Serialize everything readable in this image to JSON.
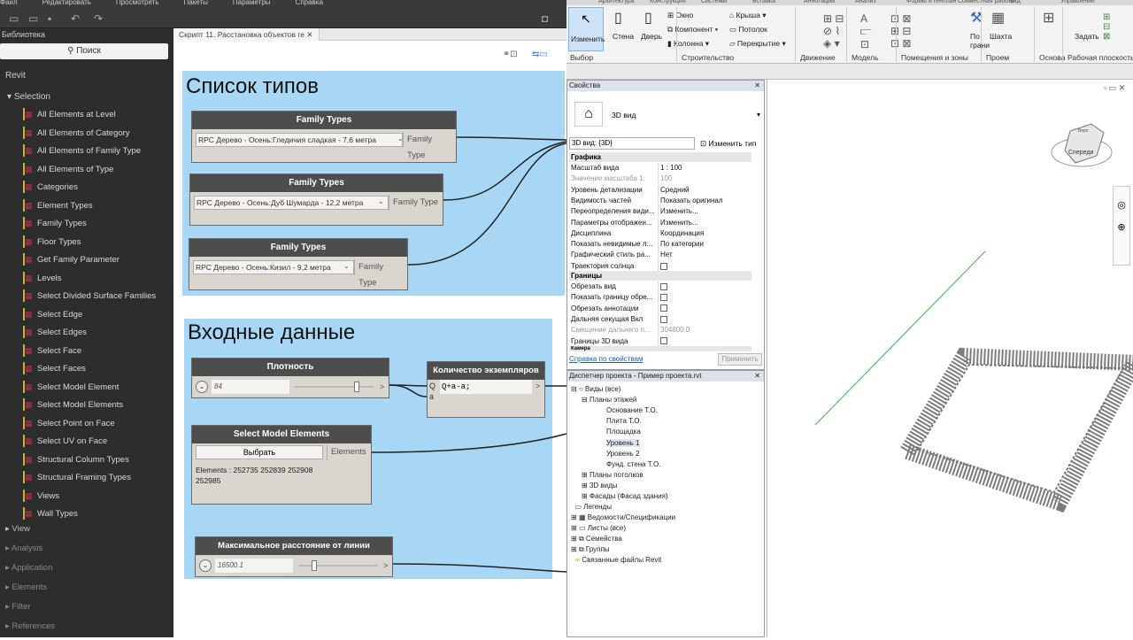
{
  "menubar": [
    "Файл",
    "Редактировать",
    "Просмотреть",
    "Пакеты",
    "Параметры",
    "Справка"
  ],
  "library": {
    "header": "Библиотека",
    "search_placeholder": "Поиск",
    "root": "Revit",
    "selection_label": "Selection",
    "items": [
      "All Elements at Level",
      "All Elements of Category",
      "All Elements of Family Type",
      "All Elements of Type",
      "Categories",
      "Element Types",
      "Family Types",
      "Floor Types",
      "Get Family Parameter",
      "Levels",
      "Select Divided Surface Families",
      "Select Edge",
      "Select Edges",
      "Select Face",
      "Select Faces",
      "Select Model Element",
      "Select Model Elements",
      "Select Point on Face",
      "Select UV on Face",
      "Structural Column Types",
      "Structural Framing Types",
      "Views",
      "Wall Types"
    ],
    "sections": [
      "View",
      "Analysis",
      "Application",
      "Elements",
      "Filter",
      "References"
    ]
  },
  "workspace": {
    "tab_label": "Скрипт 11. Расстановка объектов ге",
    "group1_title": "Список типов",
    "group2_title": "Входные данные",
    "family_nodes": [
      {
        "title": "Family Types",
        "value": "RPC Дерево - Осень:Гледичия сладкая - 7,6 метра",
        "port": "Family Type"
      },
      {
        "title": "Family Types",
        "value": "RPC Дерево - Осень:Дуб Шумарда - 12,2 метра",
        "port": "Family Type"
      },
      {
        "title": "Family Types",
        "value": "RPC Дерево - Осень:Кизил - 9,2 метра",
        "port": "Family Type"
      }
    ],
    "density_node": {
      "title": "Плотность",
      "value": "84",
      "level": 0.78
    },
    "count_node": {
      "title": "Количество экземпляров",
      "port_q": "Q",
      "port_a": "a",
      "formula": "Q+a-a;",
      "out": ">"
    },
    "select_node": {
      "title": "Select Model Elements",
      "button": "Выбрать",
      "port": "Elements",
      "result": "Elements : 252735 252839 252908 252985"
    },
    "distance_node": {
      "title": "Максимальное расстояние от линии",
      "value": "16500.1",
      "level": 0.2
    }
  },
  "ribbon": {
    "tabs": [
      "Архитектура",
      "Конструкция",
      "Системы",
      "Вставка",
      "Аннотации",
      "Анализ",
      "Формы и генплан",
      "Совместная работа",
      "Вид",
      "Управление"
    ],
    "modify": "Изменить",
    "wall": "Стена",
    "door": "Дверь",
    "window": "Окно",
    "component": "Компонент",
    "column": "Колонна",
    "roof": "Крыша",
    "ceiling": "Потолок",
    "floor": "Перекрытие",
    "by_face": "По грани",
    "shaft": "Шахта",
    "set": "Задать",
    "groups": [
      "Выбор",
      "Строительство",
      "Движение",
      "Модель",
      "Помещения и зоны",
      "Проем",
      "Основа",
      "Рабочая плоскость"
    ]
  },
  "properties": {
    "title": "Свойства",
    "type_name": "3D вид",
    "instance": "3D вид: {3D}",
    "edit_type": "Изменить тип",
    "section_graphics": "Графика",
    "rows": [
      {
        "k": "Масштаб вида",
        "v": "1 : 100"
      },
      {
        "k": "Значение масштаба  1:",
        "v": "100",
        "grey": true
      },
      {
        "k": "Уровень детализации",
        "v": "Средний"
      },
      {
        "k": "Видимость частей",
        "v": "Показать оригинал"
      },
      {
        "k": "Переопределения види...",
        "v": "Изменить..."
      },
      {
        "k": "Параметры отображен...",
        "v": "Изменить..."
      },
      {
        "k": "Дисциплина",
        "v": "Координация"
      },
      {
        "k": "Показать невидимые л...",
        "v": "По категории"
      },
      {
        "k": "Графический стиль ра...",
        "v": "Нет"
      },
      {
        "k": "Траектория солнца",
        "v": ""
      }
    ],
    "section_bounds": "Границы",
    "rows2": [
      {
        "k": "Обрезать вид",
        "v": ""
      },
      {
        "k": "Показать границу обре...",
        "v": ""
      },
      {
        "k": "Обрезать аннотации",
        "v": ""
      },
      {
        "k": "Дальняя секущая Вкл",
        "v": ""
      },
      {
        "k": "Смещение дальнего п...",
        "v": "304800.0",
        "grey": true
      },
      {
        "k": "Границы 3D вида",
        "v": ""
      }
    ],
    "camera": "Камера",
    "help_link": "Справка по свойствам",
    "apply": "Применить"
  },
  "browser": {
    "title": "Диспетчер проекта - Пример проекта.rvt",
    "views": "Виды (все)",
    "floor_plans": "Планы этажей",
    "levels": [
      "Основание Т.О.",
      "Плита Т.О.",
      "Площадка",
      "Уровень 1",
      "Уровень 2",
      "Фунд. стена Т.О."
    ],
    "ceiling_plans": "Планы потолков",
    "views3d": "3D виды",
    "facades": "Фасады (Фасад здания)",
    "legends": "Легенды",
    "schedules": "Ведомости/Спецификации",
    "sheets": "Листы (все)",
    "families": "Семейства",
    "groups": "Группы",
    "links": "Связанные файлы Revit"
  },
  "viewcube": {
    "front": "Спереди",
    "north": "Верх"
  }
}
